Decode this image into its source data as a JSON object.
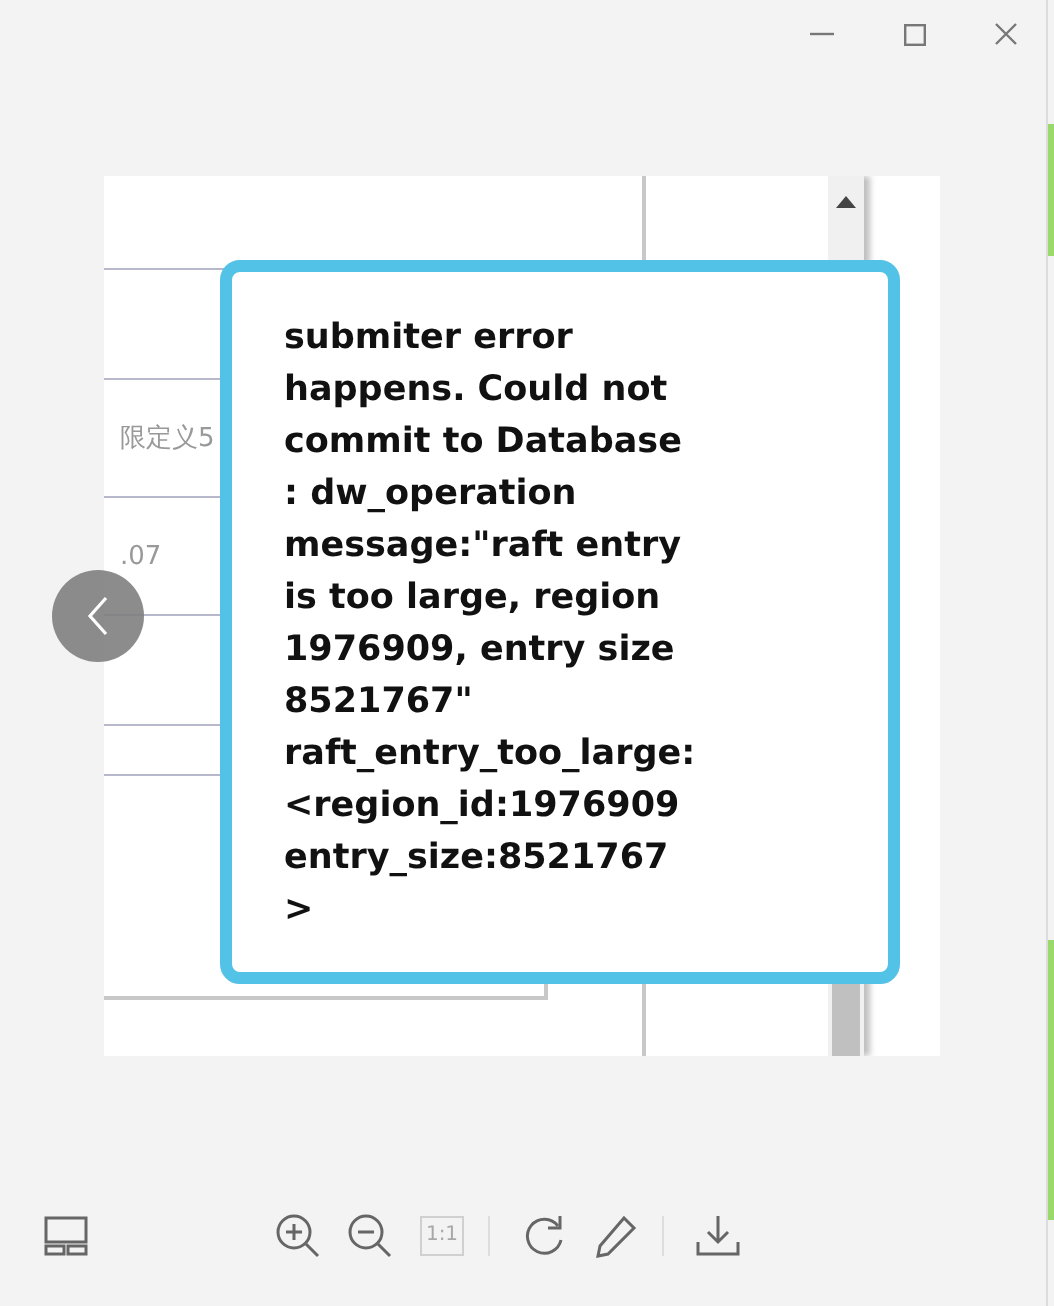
{
  "document": {
    "cells": [
      {
        "text": ""
      },
      {
        "text": "限定义5"
      },
      {
        "text": ".07"
      }
    ]
  },
  "tooltip": {
    "message": "submiter error\nhappens. Could not\ncommit to Database\n: dw_operation\nmessage:\"raft entry\nis too large, region\n1976909, entry size\n8521767\"\nraft_entry_too_large:\n<region_id:1976909\nentry_size:8521767\n>"
  },
  "toolbar": {
    "tools": [
      {
        "kind": "thumbnails",
        "disabled": false
      },
      {
        "kind": "zoom-in",
        "disabled": false
      },
      {
        "kind": "zoom-out",
        "disabled": false
      },
      {
        "kind": "actual-size",
        "label": "1:1",
        "disabled": true
      },
      {
        "kind": "divider"
      },
      {
        "kind": "rotate",
        "disabled": false
      },
      {
        "kind": "edit",
        "disabled": false
      },
      {
        "kind": "divider"
      },
      {
        "kind": "download",
        "disabled": false
      }
    ]
  }
}
